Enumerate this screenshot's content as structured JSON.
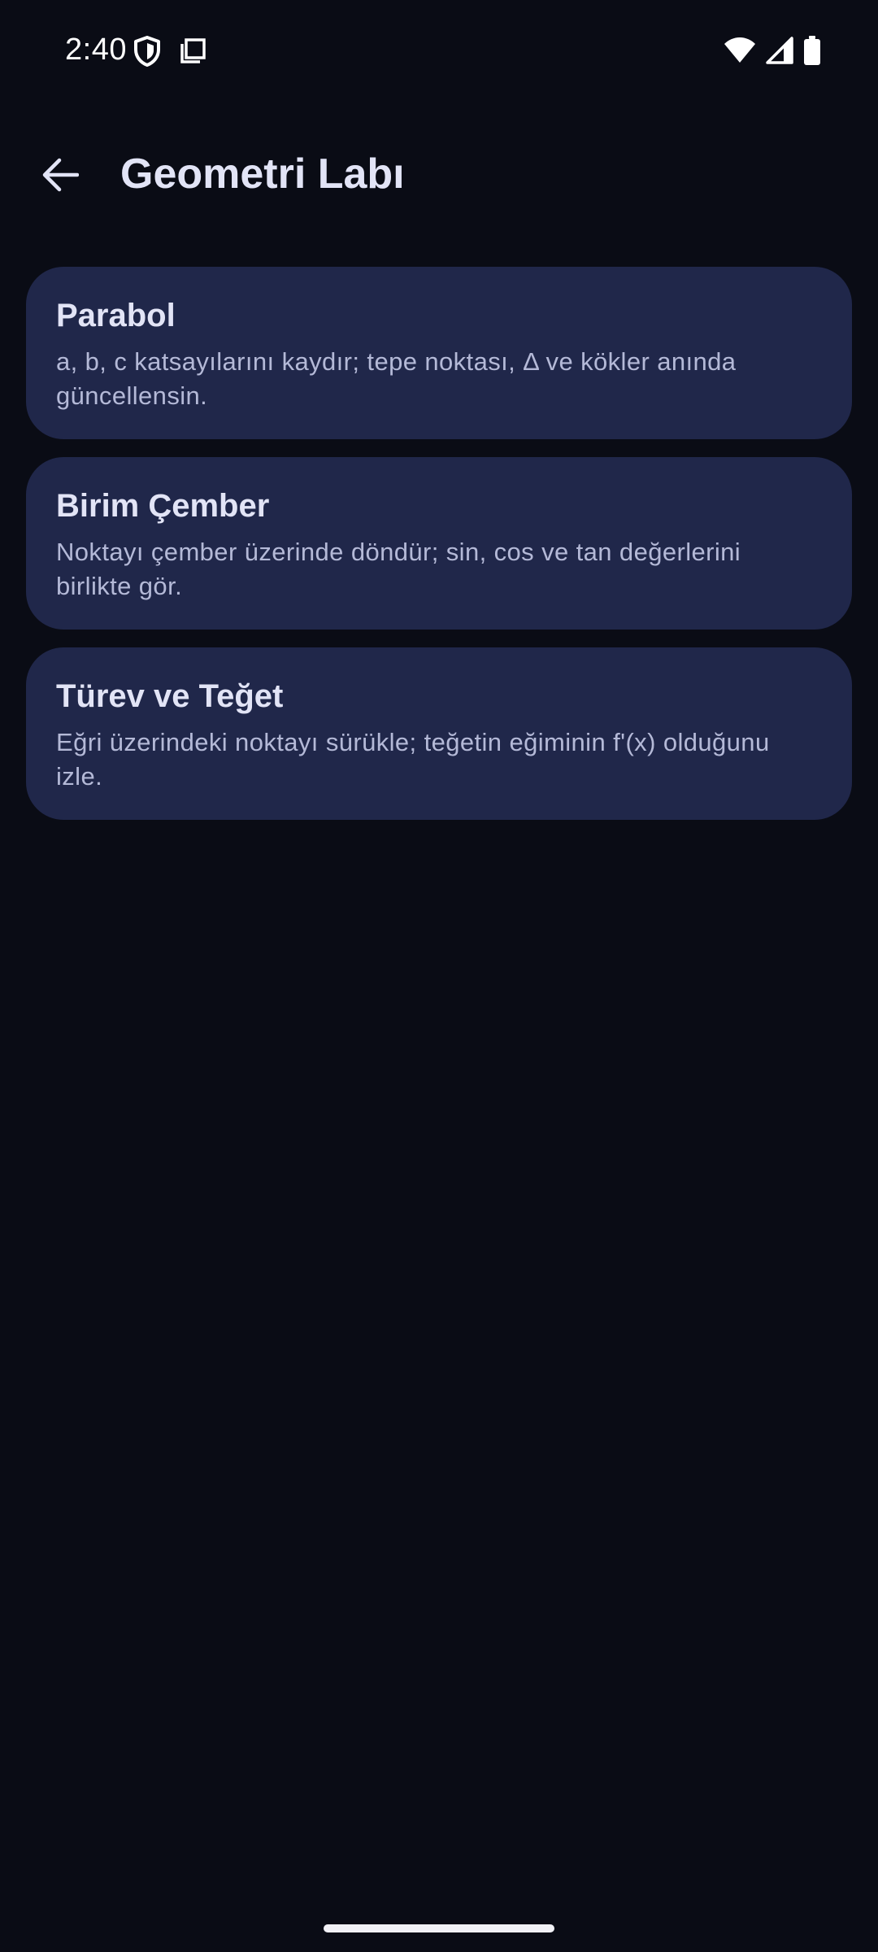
{
  "status_bar": {
    "time": "2:40",
    "left_icons": [
      "shield-icon",
      "screenshot-icon"
    ],
    "right_icons": [
      "wifi-icon",
      "cellular-signal-icon",
      "battery-icon"
    ]
  },
  "app_bar": {
    "back_icon": "arrow-back-icon",
    "title": "Geometri Labı"
  },
  "cards": [
    {
      "title": "Parabol",
      "description": "a, b, c katsayılarını kaydır; tepe noktası, Δ ve kökler anında güncellensin."
    },
    {
      "title": "Birim Çember",
      "description": "Noktayı çember üzerinde döndür; sin, cos ve tan değerlerini birlikte gör."
    },
    {
      "title": "Türev ve Teğet",
      "description": "Eğri üzerindeki noktayı sürükle; teğetin eğiminin f'(x) olduğunu izle."
    }
  ],
  "colors": {
    "background": "#0a0c15",
    "card": "#20274a",
    "title_text": "#e2e4f6",
    "body_text": "#b4b9d7"
  }
}
